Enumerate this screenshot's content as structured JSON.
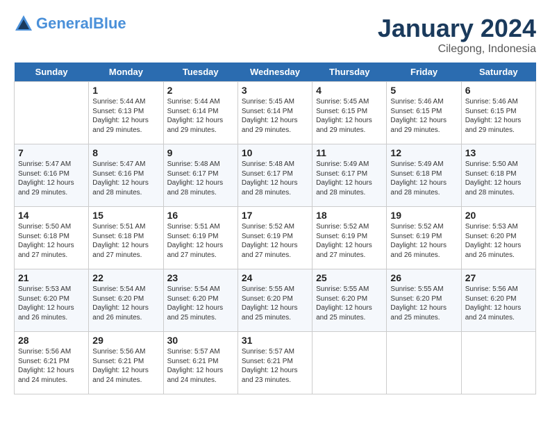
{
  "header": {
    "logo_line1": "General",
    "logo_line2": "Blue",
    "month": "January 2024",
    "location": "Cilegong, Indonesia"
  },
  "days": [
    "Sunday",
    "Monday",
    "Tuesday",
    "Wednesday",
    "Thursday",
    "Friday",
    "Saturday"
  ],
  "weeks": [
    [
      {
        "date": "",
        "info": ""
      },
      {
        "date": "1",
        "info": "Sunrise: 5:44 AM\nSunset: 6:13 PM\nDaylight: 12 hours\nand 29 minutes."
      },
      {
        "date": "2",
        "info": "Sunrise: 5:44 AM\nSunset: 6:14 PM\nDaylight: 12 hours\nand 29 minutes."
      },
      {
        "date": "3",
        "info": "Sunrise: 5:45 AM\nSunset: 6:14 PM\nDaylight: 12 hours\nand 29 minutes."
      },
      {
        "date": "4",
        "info": "Sunrise: 5:45 AM\nSunset: 6:15 PM\nDaylight: 12 hours\nand 29 minutes."
      },
      {
        "date": "5",
        "info": "Sunrise: 5:46 AM\nSunset: 6:15 PM\nDaylight: 12 hours\nand 29 minutes."
      },
      {
        "date": "6",
        "info": "Sunrise: 5:46 AM\nSunset: 6:15 PM\nDaylight: 12 hours\nand 29 minutes."
      }
    ],
    [
      {
        "date": "7",
        "info": "Sunrise: 5:47 AM\nSunset: 6:16 PM\nDaylight: 12 hours\nand 29 minutes."
      },
      {
        "date": "8",
        "info": "Sunrise: 5:47 AM\nSunset: 6:16 PM\nDaylight: 12 hours\nand 28 minutes."
      },
      {
        "date": "9",
        "info": "Sunrise: 5:48 AM\nSunset: 6:17 PM\nDaylight: 12 hours\nand 28 minutes."
      },
      {
        "date": "10",
        "info": "Sunrise: 5:48 AM\nSunset: 6:17 PM\nDaylight: 12 hours\nand 28 minutes."
      },
      {
        "date": "11",
        "info": "Sunrise: 5:49 AM\nSunset: 6:17 PM\nDaylight: 12 hours\nand 28 minutes."
      },
      {
        "date": "12",
        "info": "Sunrise: 5:49 AM\nSunset: 6:18 PM\nDaylight: 12 hours\nand 28 minutes."
      },
      {
        "date": "13",
        "info": "Sunrise: 5:50 AM\nSunset: 6:18 PM\nDaylight: 12 hours\nand 28 minutes."
      }
    ],
    [
      {
        "date": "14",
        "info": "Sunrise: 5:50 AM\nSunset: 6:18 PM\nDaylight: 12 hours\nand 27 minutes."
      },
      {
        "date": "15",
        "info": "Sunrise: 5:51 AM\nSunset: 6:18 PM\nDaylight: 12 hours\nand 27 minutes."
      },
      {
        "date": "16",
        "info": "Sunrise: 5:51 AM\nSunset: 6:19 PM\nDaylight: 12 hours\nand 27 minutes."
      },
      {
        "date": "17",
        "info": "Sunrise: 5:52 AM\nSunset: 6:19 PM\nDaylight: 12 hours\nand 27 minutes."
      },
      {
        "date": "18",
        "info": "Sunrise: 5:52 AM\nSunset: 6:19 PM\nDaylight: 12 hours\nand 27 minutes."
      },
      {
        "date": "19",
        "info": "Sunrise: 5:52 AM\nSunset: 6:19 PM\nDaylight: 12 hours\nand 26 minutes."
      },
      {
        "date": "20",
        "info": "Sunrise: 5:53 AM\nSunset: 6:20 PM\nDaylight: 12 hours\nand 26 minutes."
      }
    ],
    [
      {
        "date": "21",
        "info": "Sunrise: 5:53 AM\nSunset: 6:20 PM\nDaylight: 12 hours\nand 26 minutes."
      },
      {
        "date": "22",
        "info": "Sunrise: 5:54 AM\nSunset: 6:20 PM\nDaylight: 12 hours\nand 26 minutes."
      },
      {
        "date": "23",
        "info": "Sunrise: 5:54 AM\nSunset: 6:20 PM\nDaylight: 12 hours\nand 25 minutes."
      },
      {
        "date": "24",
        "info": "Sunrise: 5:55 AM\nSunset: 6:20 PM\nDaylight: 12 hours\nand 25 minutes."
      },
      {
        "date": "25",
        "info": "Sunrise: 5:55 AM\nSunset: 6:20 PM\nDaylight: 12 hours\nand 25 minutes."
      },
      {
        "date": "26",
        "info": "Sunrise: 5:55 AM\nSunset: 6:20 PM\nDaylight: 12 hours\nand 25 minutes."
      },
      {
        "date": "27",
        "info": "Sunrise: 5:56 AM\nSunset: 6:20 PM\nDaylight: 12 hours\nand 24 minutes."
      }
    ],
    [
      {
        "date": "28",
        "info": "Sunrise: 5:56 AM\nSunset: 6:21 PM\nDaylight: 12 hours\nand 24 minutes."
      },
      {
        "date": "29",
        "info": "Sunrise: 5:56 AM\nSunset: 6:21 PM\nDaylight: 12 hours\nand 24 minutes."
      },
      {
        "date": "30",
        "info": "Sunrise: 5:57 AM\nSunset: 6:21 PM\nDaylight: 12 hours\nand 24 minutes."
      },
      {
        "date": "31",
        "info": "Sunrise: 5:57 AM\nSunset: 6:21 PM\nDaylight: 12 hours\nand 23 minutes."
      },
      {
        "date": "",
        "info": ""
      },
      {
        "date": "",
        "info": ""
      },
      {
        "date": "",
        "info": ""
      }
    ]
  ]
}
